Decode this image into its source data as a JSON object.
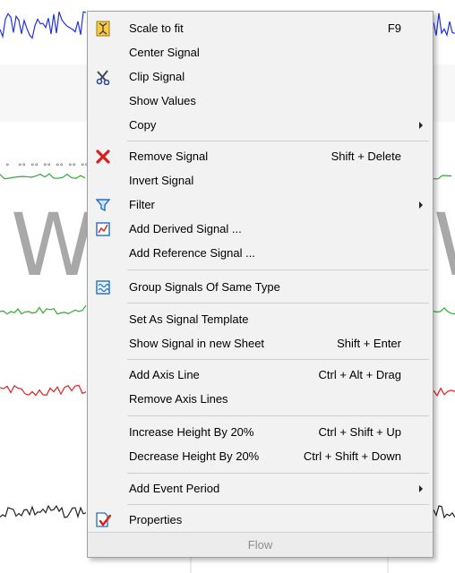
{
  "background": {
    "big_letter_left": "W",
    "big_letter_right": "W"
  },
  "menu": {
    "items": [
      {
        "label": "Scale to fit",
        "shortcut": "F9",
        "icon": "scale-to-fit-icon"
      },
      {
        "label": "Center Signal"
      },
      {
        "label": "Clip Signal",
        "icon": "scissors-icon"
      },
      {
        "label": "Show Values"
      },
      {
        "label": "Copy",
        "submenu": true
      },
      {
        "label": "Remove Signal",
        "shortcut": "Shift + Delete",
        "icon": "remove-x-icon"
      },
      {
        "label": "Invert Signal"
      },
      {
        "label": "Filter",
        "submenu": true,
        "icon": "filter-funnel-icon"
      },
      {
        "label": "Add Derived Signal ...",
        "icon": "derived-signal-icon"
      },
      {
        "label": "Add Reference Signal ..."
      },
      {
        "label": "Group Signals Of Same Type",
        "icon": "group-signals-icon"
      },
      {
        "label": "Set As Signal Template"
      },
      {
        "label": "Show Signal in new Sheet",
        "shortcut": "Shift + Enter"
      },
      {
        "label": "Add Axis Line",
        "shortcut": "Ctrl + Alt + Drag"
      },
      {
        "label": "Remove Axis Lines"
      },
      {
        "label": "Increase Height By 20%",
        "shortcut": "Ctrl + Shift + Up"
      },
      {
        "label": "Decrease Height By 20%",
        "shortcut": "Ctrl + Shift + Down"
      },
      {
        "label": "Add Event Period",
        "submenu": true
      },
      {
        "label": "Properties",
        "icon": "properties-icon"
      }
    ],
    "footer": "Flow"
  },
  "colors": {
    "menu_bg": "#f2f2f2",
    "blue_signal": "#2233dd",
    "green_signal": "#33aa33",
    "red_signal": "#dd2222",
    "black_signal": "#222222",
    "remove_icon": "#d81e1e"
  }
}
